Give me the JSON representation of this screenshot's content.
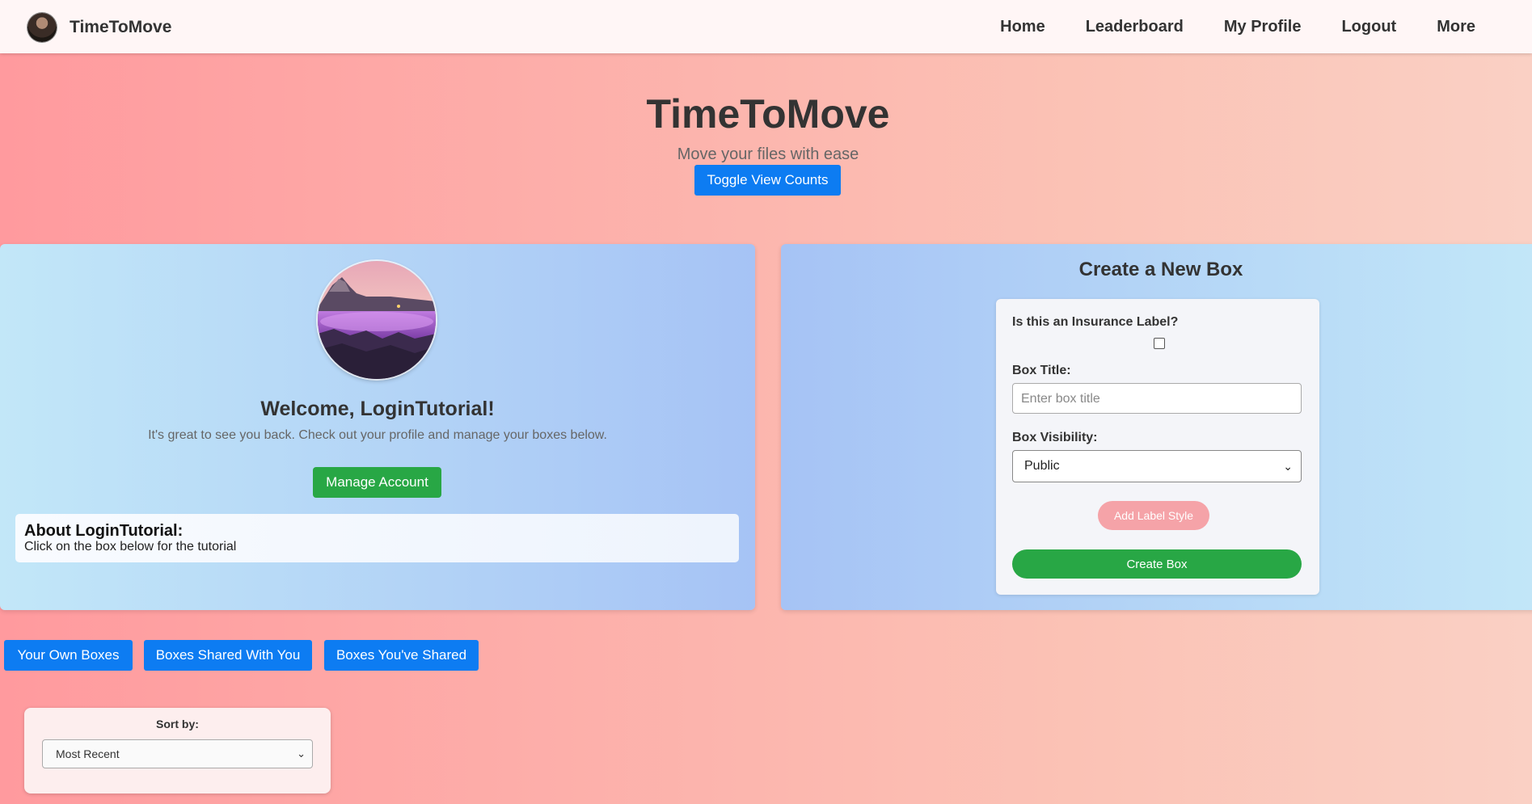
{
  "colors": {
    "primary_blue": "#0d7cf2",
    "success_green": "#28a745",
    "pink_button": "#f5a3a8",
    "background_start": "#ff9a9e",
    "background_end": "#fad0c4"
  },
  "navbar": {
    "brand": "TimeToMove",
    "links": [
      "Home",
      "Leaderboard",
      "My Profile",
      "Logout",
      "More"
    ]
  },
  "hero": {
    "title": "TimeToMove",
    "subtitle": "Move your files with ease",
    "toggle_label": "Toggle View Counts"
  },
  "profile": {
    "welcome": "Welcome, LoginTutorial!",
    "subtitle": "It's great to see you back. Check out your profile and manage your boxes below.",
    "manage_label": "Manage Account",
    "about_title": "About LoginTutorial:",
    "about_text": "Click on the box below for the tutorial"
  },
  "create_box": {
    "title": "Create a New Box",
    "insurance_label": "Is this an Insurance Label?",
    "insurance_checked": false,
    "title_label": "Box Title:",
    "title_placeholder": "Enter box title",
    "visibility_label": "Box Visibility:",
    "visibility_value": "Public",
    "add_style_label": "Add Label Style",
    "create_label": "Create Box"
  },
  "tabs": [
    "Your Own Boxes",
    "Boxes Shared With You",
    "Boxes You've Shared"
  ],
  "sort": {
    "label": "Sort by:",
    "value": "Most Recent"
  }
}
